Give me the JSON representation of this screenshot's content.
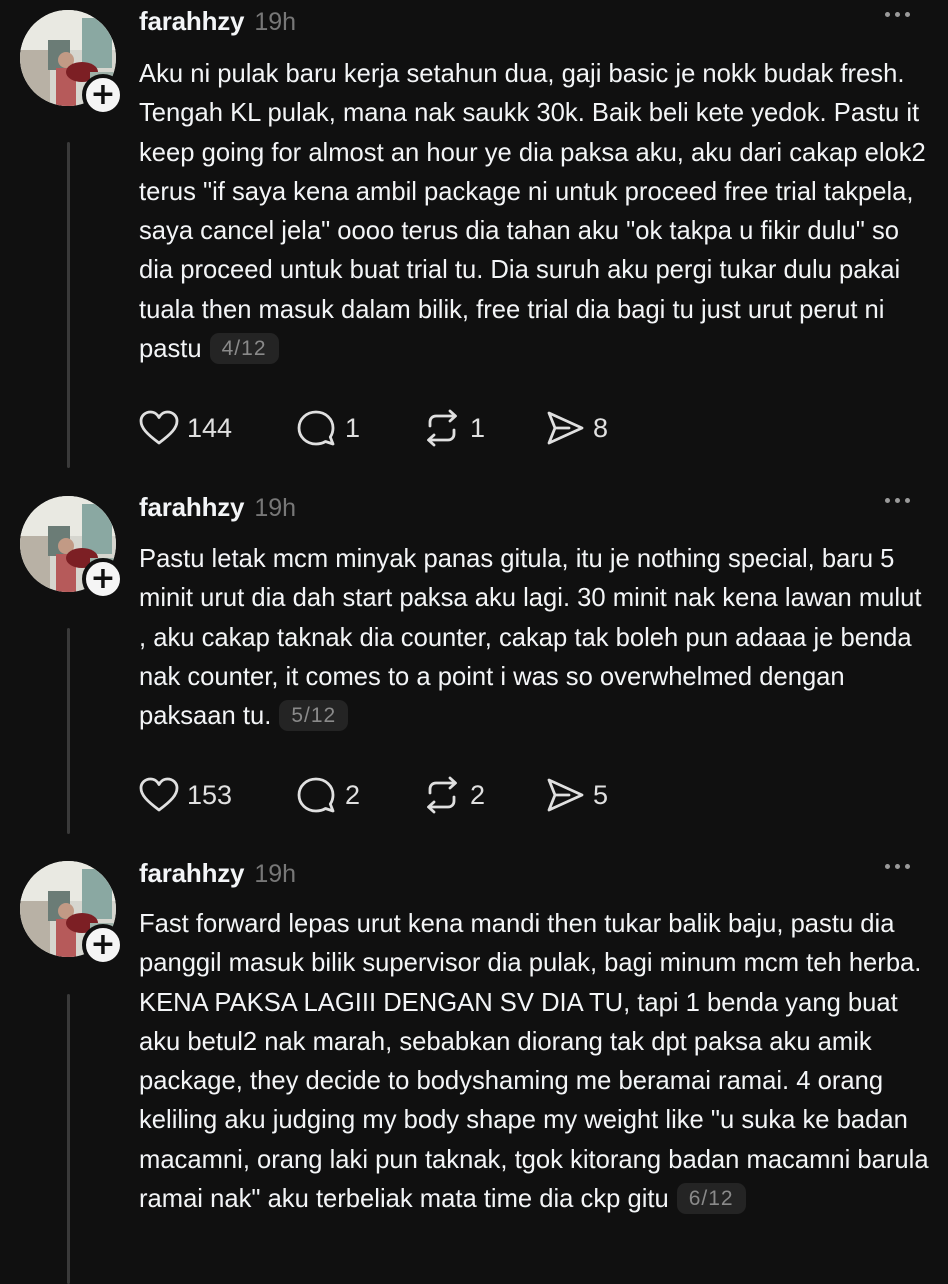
{
  "posts": [
    {
      "username": "farahhzy",
      "time": "19h",
      "body": "Aku ni pulak baru kerja setahun dua, gaji basic je nokk budak fresh. Tengah KL pulak, mana nak saukk 30k. Baik beli kete yedok. Pastu it keep going for almost an hour ye dia paksa aku, aku dari cakap elok2 terus \"if saya kena ambil package ni untuk proceed free trial takpela, saya cancel jela\" oooo terus dia tahan aku \"ok takpa u fikir dulu\" so dia proceed untuk buat trial tu. Dia suruh aku pergi tukar dulu pakai tuala then masuk dalam bilik, free trial dia bagi tu just urut perut ni pastu",
      "page": "4/12",
      "likes": "144",
      "replies": "1",
      "reposts": "1",
      "shares": "8"
    },
    {
      "username": "farahhzy",
      "time": "19h",
      "body": "Pastu letak mcm minyak panas gitula, itu je nothing special, baru 5 minit urut dia dah start paksa aku lagi. 30 minit nak kena lawan mulut , aku cakap taknak dia counter, cakap tak boleh pun adaaa je benda nak counter, it comes to a point i was so overwhelmed dengan paksaan tu.",
      "page": "5/12",
      "likes": "153",
      "replies": "2",
      "reposts": "2",
      "shares": "5"
    },
    {
      "username": "farahhzy",
      "time": "19h",
      "body": "Fast forward lepas urut kena mandi then tukar balik baju, pastu dia panggil masuk bilik supervisor dia pulak, bagi minum mcm teh herba. KENA PAKSA LAGIII DENGAN SV DIA TU, tapi 1 benda yang buat aku betul2 nak marah, sebabkan diorang tak dpt paksa aku amik package, they decide to bodyshaming me beramai ramai. 4 orang keliling aku judging my body shape my weight like \"u suka ke badan macamni, orang laki pun taknak, tgok kitorang badan macamni barula ramai nak\" aku terbeliak mata time dia ckp gitu",
      "page": "6/12"
    }
  ],
  "icons": {
    "like": "heart-icon",
    "reply": "comment-icon",
    "repost": "repost-icon",
    "share": "send-icon",
    "more": "more-options-icon",
    "follow": "plus-icon"
  },
  "colors": {
    "background": "#101010",
    "text": "#f3f5f7",
    "muted": "#777777",
    "thread_line": "#3a3a3a"
  }
}
